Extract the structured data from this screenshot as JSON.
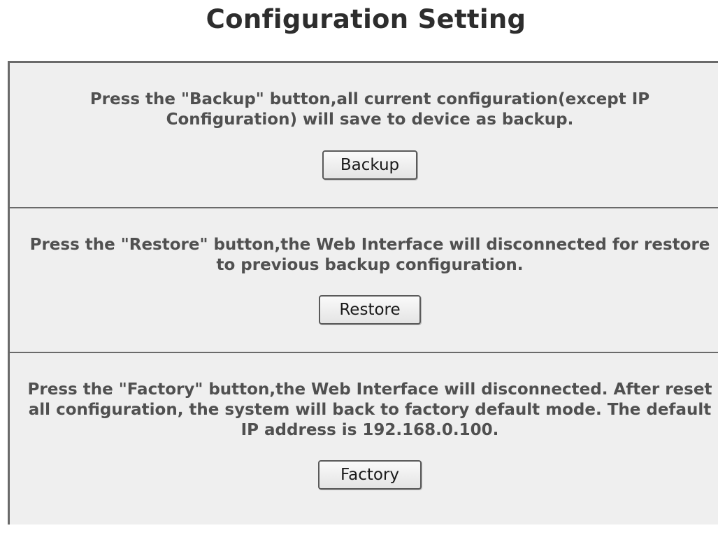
{
  "page": {
    "title": "Configuration Setting"
  },
  "sections": {
    "backup": {
      "description_line1": "Press the \"Backup\" button,all current configuration(except IP",
      "description_line2": "Configuration) will save to device as backup.",
      "button_label": "Backup"
    },
    "restore": {
      "description_line1": "Press the \"Restore\" button,the Web Interface will disconnected for restore",
      "description_line2": "to previous backup configuration.",
      "button_label": "Restore"
    },
    "factory": {
      "description_line1": "Press the \"Factory\" button,the Web Interface will disconnected. After reset",
      "description_line2": "all configuration, the system will back to factory default mode. The default",
      "description_line3": "IP address is 192.168.0.100.",
      "button_label": "Factory"
    }
  },
  "colors": {
    "panel_background": "#efefef",
    "border": "#6a6a6a",
    "title_text": "#2d2d2d",
    "description_text": "#505050"
  }
}
